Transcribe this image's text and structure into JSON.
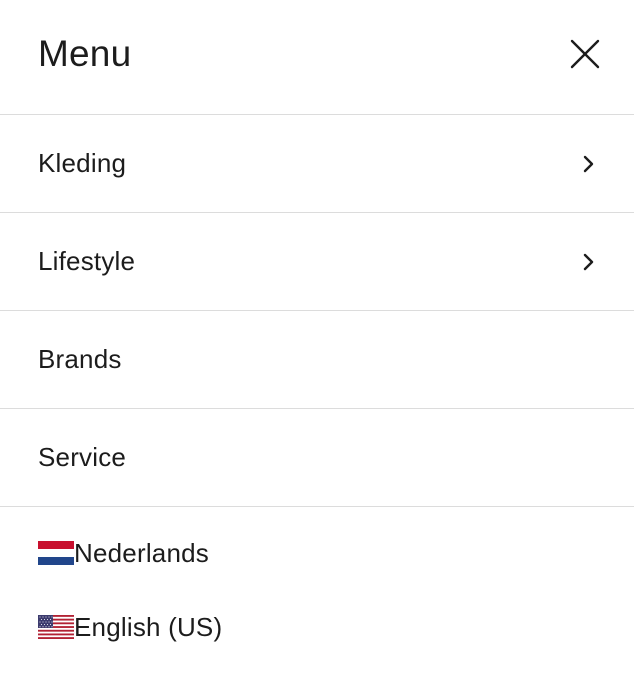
{
  "header": {
    "title": "Menu",
    "close_icon": "close-icon"
  },
  "nav": {
    "items": [
      {
        "label": "Kleding",
        "has_submenu": true,
        "icon": "chevron-right-icon"
      },
      {
        "label": "Lifestyle",
        "has_submenu": true,
        "icon": "chevron-right-icon"
      },
      {
        "label": "Brands",
        "has_submenu": false
      },
      {
        "label": "Service",
        "has_submenu": false
      }
    ]
  },
  "languages": {
    "items": [
      {
        "label": "Nederlands",
        "flag": "flag-netherlands-icon"
      },
      {
        "label": "English (US)",
        "flag": "flag-us-icon"
      }
    ]
  },
  "colors": {
    "text": "#1c1c1c",
    "divider": "#dcdcdc",
    "background": "#ffffff",
    "nl_red": "#c8102e",
    "nl_blue": "#21468b",
    "us_red": "#b22234",
    "us_blue": "#3c3b6e"
  }
}
